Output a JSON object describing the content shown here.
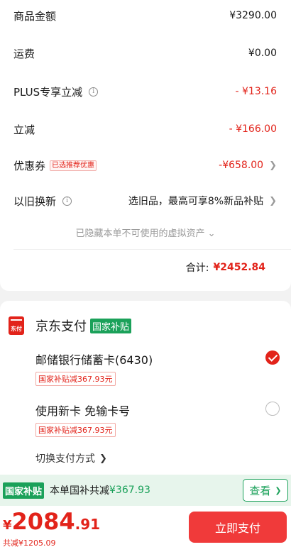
{
  "summary": {
    "rows": [
      {
        "label": "商品金额",
        "value": "¥3290.00"
      },
      {
        "label": "运费",
        "value": "¥0.00"
      },
      {
        "label": "PLUS专享立减",
        "value": "- ¥13.16"
      },
      {
        "label": "立减",
        "value": "- ¥166.00"
      },
      {
        "label": "优惠券",
        "tag": "已选推荐优惠",
        "value": "-¥658.00"
      },
      {
        "label": "以旧换新",
        "value": "选旧品，最高可享8%新品补贴"
      }
    ],
    "hidden_assets": "已隐藏本单不可使用的虚拟资产",
    "total_label": "合计:",
    "total_value": "¥2452.84"
  },
  "payment": {
    "logo_text": "东付",
    "title": "京东支付",
    "badge": "国家补贴",
    "options": [
      {
        "name": "邮储银行储蓄卡(6430)",
        "tag": "国家补贴减367.93元",
        "selected": true
      },
      {
        "name": "使用新卡 免输卡号",
        "tag": "国家补贴减367.93元",
        "selected": false
      }
    ],
    "switch_label": "切换支付方式"
  },
  "subsidy_bar": {
    "badge": "国家补贴",
    "text": "本单国补共减",
    "amount": "¥367.93",
    "button": "查看"
  },
  "bottom": {
    "currency": "¥",
    "price_int": "2084",
    "price_dec": ".91",
    "saved": "共减¥1205.09",
    "pay_button": "立即支付"
  },
  "colors": {
    "accent_red": "#e2231a",
    "subsidy_green": "#1ba15a"
  }
}
